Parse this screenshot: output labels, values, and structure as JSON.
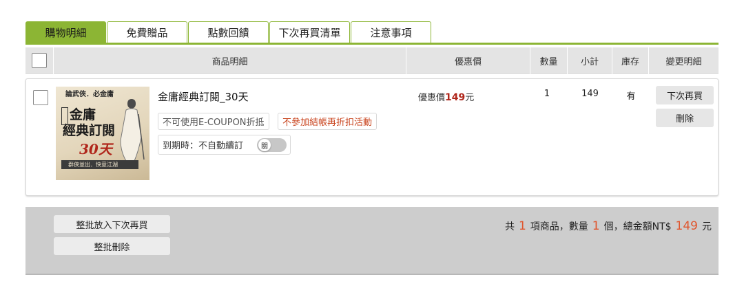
{
  "tabs": [
    {
      "label": "購物明細",
      "active": true
    },
    {
      "label": "免費贈品",
      "active": false
    },
    {
      "label": "點數回饋",
      "active": false
    },
    {
      "label": "下次再買清單",
      "active": false
    },
    {
      "label": "注意事項",
      "active": false
    }
  ],
  "table_header": {
    "product": "商品明細",
    "price": "優惠價",
    "quantity": "數量",
    "subtotal": "小計",
    "stock": "庫存",
    "actions": "變更明細"
  },
  "item": {
    "cover": {
      "top_text": "論武俠．必金庸",
      "line1": "金庸",
      "line2": "經典訂閱",
      "line3": "30天",
      "band_text": "群俠並出．快意江湖"
    },
    "title": "金庸經典訂閱_30天",
    "tag_coupon": "不可使用E-COUPON折抵",
    "tag_discount": "不參加結帳再折扣活動",
    "renew_label": "到期時：不自動續訂",
    "renew_toggle": "關",
    "price_prefix": "優惠價",
    "price_value": "149",
    "price_unit": "元",
    "quantity": "1",
    "subtotal": "149",
    "stock": "有",
    "buy_later_label": "下次再買",
    "delete_label": "刪除"
  },
  "footer": {
    "batch_later_label": "整批放入下次再買",
    "batch_delete_label": "整批刪除",
    "summary_prefix": "共",
    "item_count": "1",
    "summary_mid1": "項商品，數量",
    "total_quantity": "1",
    "summary_mid2": "個，總金額NT$",
    "total_amount": "149",
    "summary_suffix": "元"
  },
  "colors": {
    "tab_accent": "#8cb534",
    "price_red": "#b0261b",
    "highlight_orange": "#e0542b"
  }
}
